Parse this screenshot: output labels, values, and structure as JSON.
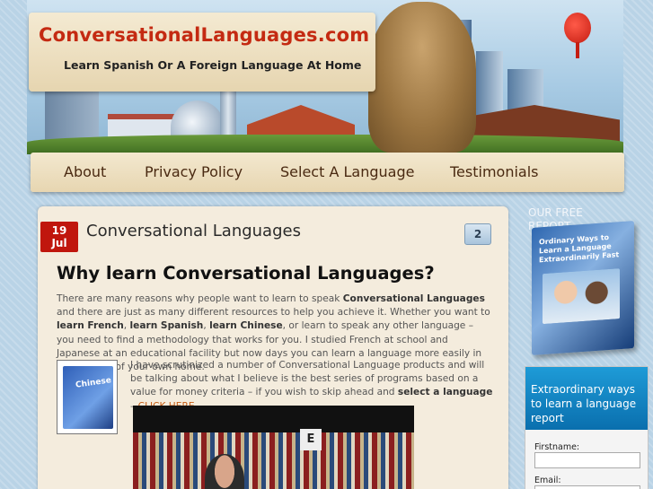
{
  "header": {
    "site_title": "ConversationalLanguages.com",
    "tagline": "Learn Spanish Or A Foreign Language At Home"
  },
  "nav": {
    "items": [
      {
        "label": "About"
      },
      {
        "label": "Privacy Policy"
      },
      {
        "label": "Select A Language"
      },
      {
        "label": "Testimonials"
      }
    ]
  },
  "post": {
    "date_day": "19",
    "date_month": "Jul",
    "title": "Conversational Languages",
    "comment_count": "2",
    "heading": "Why learn Conversational Languages?",
    "para1": {
      "t1": "There are many reasons why people want to learn to speak ",
      "b1": "Conversational Languages",
      "t2": " and there are just as many different resources to help you achieve it. Whether you want to ",
      "b2": "learn French",
      "t3": ", ",
      "b3": "learn Spanish",
      "t4": ", ",
      "b4": "learn Chinese",
      "t5": ", or learn to speak any other language – you need to find a methodology that works for you. I studied French at school and Japanese at an educational facility but now days you can learn a language more easily in the comfort of your own home."
    },
    "para2": {
      "t1": "I have scrutinized a number of Conversational Language products and will be talking about what I believe is the best series of programs based on a value for money criteria – if you wish to skip ahead and ",
      "b1": "select a language",
      "t2": " – ",
      "link": "CLICK HERE"
    },
    "product_image_label": "Chinese",
    "video_letter": "E"
  },
  "sidebar": {
    "free_report_label": "OUR FREE REPORT",
    "report_title": "Ordinary Ways to Learn a Language Extraordinarily Fast",
    "optin_heading": "Extraordinary ways to learn a language report",
    "firstname_label": "Firstname:",
    "email_label": "Email:"
  },
  "colors": {
    "title_red": "#c42a12",
    "date_badge": "#c0160d",
    "link_orange": "#c45a10",
    "optin_blue": "#0a6fae"
  }
}
